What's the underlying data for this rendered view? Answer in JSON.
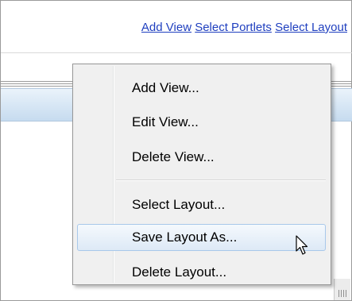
{
  "toolbar": {
    "links": [
      "Add View",
      "Select Portlets",
      "Select Layout"
    ]
  },
  "context_menu": {
    "items": [
      "Add View...",
      "Edit View...",
      "Delete View...",
      "Select Layout...",
      "Save Layout As...",
      "Delete Layout..."
    ],
    "hovered_item": "Save Layout As..."
  },
  "icons": {
    "cursor": "mouse-pointer-icon",
    "grip": "resize-grip-icon"
  },
  "colors": {
    "link": "#1f3fbf",
    "menu_background": "#f0f0f0",
    "hover_border": "#a8c8ea",
    "header_band": "#c6dbef"
  }
}
